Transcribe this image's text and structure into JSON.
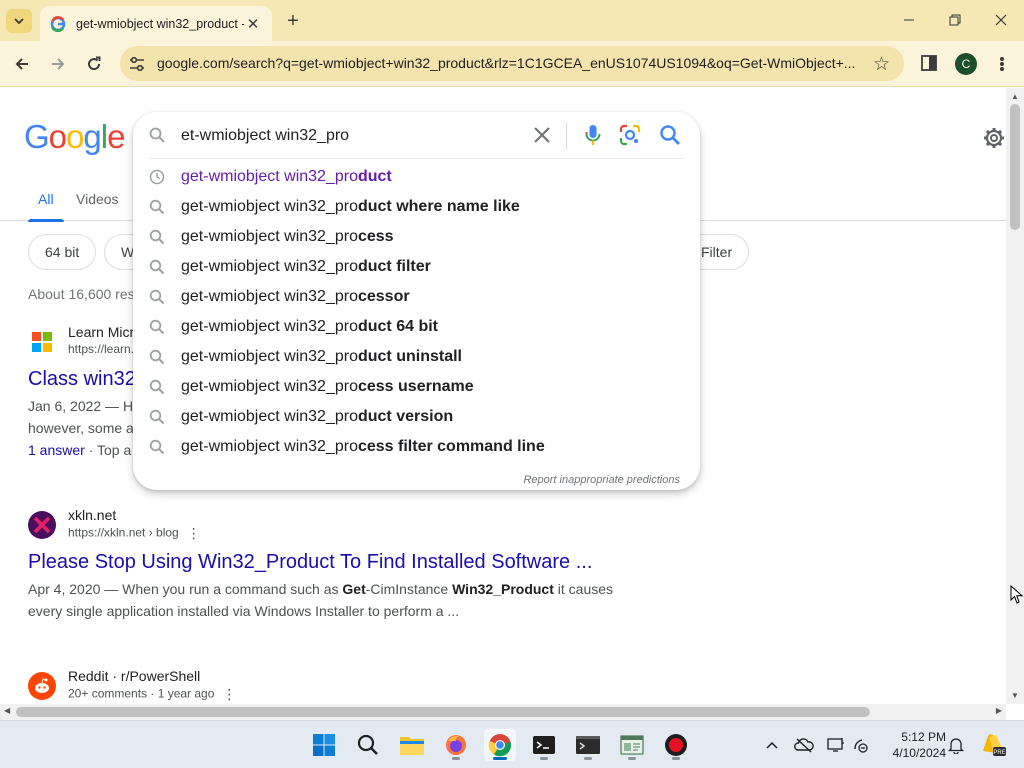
{
  "browser": {
    "tab_title": "get-wmiobject win32_product -",
    "url": "google.com/search?q=get-wmiobject+win32_product&rlz=1C1GCEA_enUS1074US1094&oq=Get-WmiObject+...",
    "profile_initial": "C"
  },
  "search": {
    "query": "et-wmiobject win32_pro",
    "tabs": [
      {
        "label": "All"
      },
      {
        "label": "Videos"
      }
    ],
    "chips": [
      {
        "label": "64 bit"
      },
      {
        "label": "W"
      },
      {
        "label": "Filter"
      }
    ],
    "stats": "About 16,600 res"
  },
  "suggestions": {
    "items": [
      {
        "typed": "get-wmiobject win32_pro",
        "completion": "duct",
        "type": "history"
      },
      {
        "typed": "get-wmiobject win32_pro",
        "completion": "duct where name like",
        "type": "search"
      },
      {
        "typed": "get-wmiobject win32_pro",
        "completion": "cess",
        "type": "search"
      },
      {
        "typed": "get-wmiobject win32_pro",
        "completion": "duct filter",
        "type": "search"
      },
      {
        "typed": "get-wmiobject win32_pro",
        "completion": "cessor",
        "type": "search"
      },
      {
        "typed": "get-wmiobject win32_pro",
        "completion": "duct 64 bit",
        "type": "search"
      },
      {
        "typed": "get-wmiobject win32_pro",
        "completion": "duct uninstall",
        "type": "search"
      },
      {
        "typed": "get-wmiobject win32_pro",
        "completion": "cess username",
        "type": "search"
      },
      {
        "typed": "get-wmiobject win32_pro",
        "completion": "duct version",
        "type": "search"
      },
      {
        "typed": "get-wmiobject win32_pro",
        "completion": "cess filter command line",
        "type": "search"
      }
    ],
    "report_label": "Report inappropriate predictions"
  },
  "results": [
    {
      "site_name": "Learn Micr",
      "url": "https://learn.",
      "title": "Class win32",
      "snippet_1": "Jan 6, 2022 — H",
      "snippet_2": "however, some a",
      "answer_link": "1 answer",
      "answer_extra": " · Top a"
    },
    {
      "site_name": "xkln.net",
      "url": "https://xkln.net › blog",
      "title": "Please Stop Using Win32_Product To Find Installed Software ...",
      "snippet_date": "Apr 4, 2020 — When you run a command such as ",
      "snippet_b1": "Get",
      "snippet_mid": "-CimInstance ",
      "snippet_b2": "Win32_Product",
      "snippet_end": " it causes",
      "snippet_line2": "every single application installed via Windows Installer to perform a ..."
    },
    {
      "site_name": "Reddit · r/PowerShell",
      "url": "20+ comments · 1 year ago"
    }
  ],
  "taskbar": {
    "time": "5:12 PM",
    "date": "4/10/2024"
  },
  "colors": {
    "chrome_frame": "#f6e8b4",
    "chrome_toolbar": "#fbf4da",
    "link_blue": "#1a0dab",
    "visited_purple": "#681da8",
    "google_blue": "#1a73e8"
  }
}
